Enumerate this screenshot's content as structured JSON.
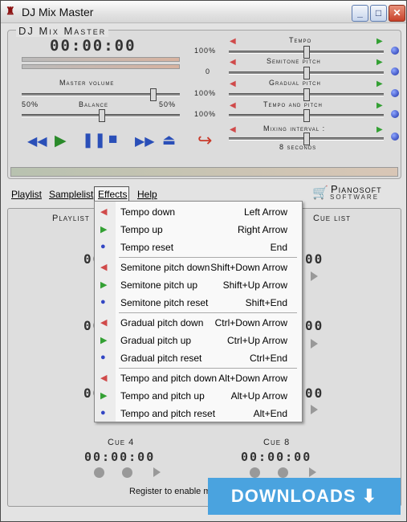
{
  "window": {
    "title": "DJ Mix Master"
  },
  "header": {
    "app_name": "DJ Mix Master",
    "time": "00:00:00"
  },
  "left": {
    "master_volume_label": "Master volume",
    "balance_label": "Balance",
    "balance_left": "50%",
    "balance_right": "50%"
  },
  "right": {
    "tempo": {
      "label": "Tempo",
      "value": "100%"
    },
    "semitone": {
      "label": "Semitone pitch",
      "value": "0"
    },
    "gradual": {
      "label": "Gradual pitch",
      "value": "100%"
    },
    "tempo_pitch": {
      "label": "Tempo and pitch",
      "value": "100%"
    },
    "mixing": {
      "label": "Mixing interval :",
      "value": "8 seconds"
    }
  },
  "menu": {
    "playlist": "Playlist",
    "samplelist": "Samplelist",
    "effects": "Effects",
    "help": "Help"
  },
  "brand": {
    "name": "Pianosoft",
    "sub": "Software"
  },
  "tabs": {
    "playlist": "Playlist",
    "cue_list": "Cue list"
  },
  "dropdown": [
    {
      "label": "Tempo down",
      "shortcut": "Left Arrow",
      "icon": "arrow-left-icon"
    },
    {
      "label": "Tempo up",
      "shortcut": "Right Arrow",
      "icon": "arrow-right-icon"
    },
    {
      "label": "Tempo reset",
      "shortcut": "End",
      "icon": "dot-icon"
    },
    {
      "label": "Semitone pitch down",
      "shortcut": "Shift+Down Arrow",
      "icon": "arrow-left-icon"
    },
    {
      "label": "Semitone pitch up",
      "shortcut": "Shift+Up Arrow",
      "icon": "arrow-right-icon"
    },
    {
      "label": "Semitone pitch reset",
      "shortcut": "Shift+End",
      "icon": "dot-icon"
    },
    {
      "label": "Gradual pitch down",
      "shortcut": "Ctrl+Down Arrow",
      "icon": "arrow-left-icon"
    },
    {
      "label": "Gradual pitch up",
      "shortcut": "Ctrl+Up Arrow",
      "icon": "arrow-right-icon"
    },
    {
      "label": "Gradual pitch reset",
      "shortcut": "Ctrl+End",
      "icon": "dot-icon"
    },
    {
      "label": "Tempo and pitch down",
      "shortcut": "Alt+Down Arrow",
      "icon": "arrow-left-icon"
    },
    {
      "label": "Tempo and pitch up",
      "shortcut": "Alt+Up Arrow",
      "icon": "arrow-right-icon"
    },
    {
      "label": "Tempo and pitch reset",
      "shortcut": "Alt+End",
      "icon": "dot-icon"
    }
  ],
  "cues": {
    "cue4": "Cue 4",
    "cue8": "Cue 8",
    "time": "00:00:00"
  },
  "register_text": "Register to enable multiple sound cards",
  "watermark": "DOWNLOADS ⬇ .GURU"
}
